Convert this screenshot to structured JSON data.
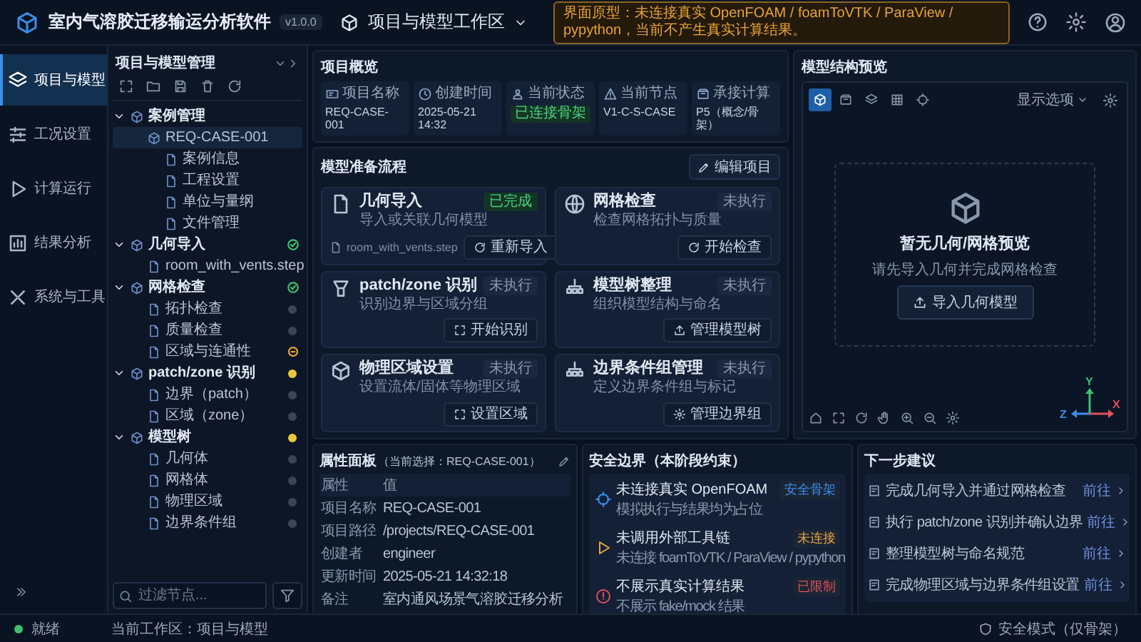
{
  "header": {
    "app_title": "室内气溶胶迁移输运分析软件",
    "version": "v1.0.0",
    "workspace": "项目与模型工作区",
    "notice": "界面原型：未连接真实 OpenFOAM / foamToVTK / ParaView / pypython，当前不产生真实计算结果。"
  },
  "nav": {
    "items": [
      {
        "label": "项目与模型",
        "selected": true
      },
      {
        "label": "工况设置",
        "selected": false
      },
      {
        "label": "计算运行",
        "selected": false
      },
      {
        "label": "结果分析",
        "selected": false
      },
      {
        "label": "系统与工具",
        "selected": false
      }
    ]
  },
  "tree_panel": {
    "title": "项目与模型管理",
    "filter_placeholder": "过滤节点...",
    "nodes": [
      {
        "label": "案例管理",
        "expanded": true,
        "selected": false,
        "children": [
          {
            "label": "REQ-CASE-001",
            "selected": true,
            "children": [
              {
                "label": "案例信息",
                "selected": false
              },
              {
                "label": "工程设置",
                "selected": false
              },
              {
                "label": "单位与量纲",
                "selected": false
              },
              {
                "label": "文件管理",
                "selected": false
              }
            ]
          }
        ]
      },
      {
        "label": "几何导入",
        "expanded": true,
        "selected": false,
        "kind": "check",
        "color": "#3fbf6f",
        "children": [
          {
            "label": "room_with_vents.step",
            "selected": false
          }
        ]
      },
      {
        "label": "网格检查",
        "expanded": true,
        "selected": false,
        "kind": "check",
        "color": "#3fbf6f",
        "children": [
          {
            "label": "拓扑检查",
            "selected": false,
            "kind": "dot",
            "color": "#3a4658"
          },
          {
            "label": "质量检查",
            "selected": false,
            "kind": "dot",
            "color": "#3a4658"
          },
          {
            "label": "区域与连通性",
            "selected": false,
            "kind": "ring",
            "color": "#e8a33a"
          }
        ]
      },
      {
        "label": "patch/zone 识别",
        "expanded": true,
        "selected": false,
        "kind": "dot",
        "color": "#e8c53a",
        "children": [
          {
            "label": "边界（patch）",
            "selected": false,
            "kind": "dot",
            "color": "#3a4658"
          },
          {
            "label": "区域（zone）",
            "selected": false,
            "kind": "dot",
            "color": "#3a4658"
          }
        ]
      },
      {
        "label": "模型树",
        "expanded": true,
        "selected": false,
        "kind": "dot",
        "color": "#e8c53a",
        "children": [
          {
            "label": "几何体",
            "selected": false,
            "kind": "dot",
            "color": "#3a4658"
          },
          {
            "label": "网格体",
            "selected": false,
            "kind": "dot",
            "color": "#3a4658"
          },
          {
            "label": "物理区域",
            "selected": false,
            "kind": "dot",
            "color": "#3a4658"
          },
          {
            "label": "边界条件组",
            "selected": false,
            "kind": "dot",
            "color": "#3a4658"
          }
        ]
      }
    ]
  },
  "overview": {
    "title": "项目概览",
    "cards": [
      {
        "label": "项目名称",
        "value": "REQ-CASE-001",
        "kind": "text"
      },
      {
        "label": "创建时间",
        "value": "2025-05-21 14:32",
        "kind": "text"
      },
      {
        "label": "当前状态",
        "value": "已连接骨架",
        "kind": "badge"
      },
      {
        "label": "当前节点",
        "value": "V1-C-S-CASE",
        "kind": "text"
      },
      {
        "label": "承接计算",
        "value": "P5（概念/骨架）",
        "kind": "text"
      }
    ]
  },
  "flow": {
    "title": "模型准备流程",
    "edit_button": "编辑项目",
    "steps": [
      {
        "title": "几何导入",
        "desc": "导入或关联几何模型",
        "done": true,
        "badge": "已完成",
        "file": "room_with_vents.step",
        "action": "重新导入"
      },
      {
        "title": "网格检查",
        "desc": "检查网格拓扑与质量",
        "done": false,
        "badge": "未执行",
        "action": "开始检查"
      },
      {
        "title": "patch/zone 识别",
        "desc": "识别边界与区域分组",
        "done": false,
        "badge": "未执行",
        "action": "开始识别"
      },
      {
        "title": "模型树整理",
        "desc": "组织模型结构与命名",
        "done": false,
        "badge": "未执行",
        "action": "管理模型树"
      },
      {
        "title": "物理区域设置",
        "desc": "设置流体/固体等物理区域",
        "done": false,
        "badge": "未执行",
        "action": "设置区域"
      },
      {
        "title": "边界条件组管理",
        "desc": "定义边界条件组与标记",
        "done": false,
        "badge": "未执行",
        "action": "管理边界组"
      }
    ]
  },
  "preview": {
    "title": "模型结构预览",
    "view_modes": [
      {
        "selected": true
      },
      {
        "selected": false
      },
      {
        "selected": false
      },
      {
        "selected": false
      },
      {
        "selected": false
      }
    ],
    "display_options": "显示选项",
    "empty_title": "暂无几何/网格预览",
    "empty_hint": "请先导入几何并完成网格检查",
    "import_button": "导入几何模型",
    "axes": {
      "y": "Y",
      "z": "Z",
      "x": "X"
    }
  },
  "properties": {
    "title": "属性面板",
    "selection": "（当前选择：REQ-CASE-001）",
    "columns": [
      "属性",
      "值"
    ],
    "rows": [
      [
        "项目名称",
        "REQ-CASE-001"
      ],
      [
        "项目路径",
        "/projects/REQ-CASE-001"
      ],
      [
        "创建者",
        "engineer"
      ],
      [
        "更新时间",
        "2025-05-21 14:32:18"
      ],
      [
        "备注",
        "室内通风场景气溶胶迁移分析"
      ]
    ]
  },
  "safety": {
    "title": "安全边界（本阶段约束）",
    "items": [
      {
        "title": "未连接真实 OpenFOAM",
        "desc": "模拟执行与结果均为占位",
        "badge": "安全骨架",
        "color": "#3b8eea"
      },
      {
        "title": "未调用外部工具链",
        "desc": "未连接 foamToVTK / ParaView / pypython",
        "badge": "未连接",
        "color": "#e8a33a"
      },
      {
        "title": "不展示真实计算结果",
        "desc": "不展示 fake/mock 结果",
        "badge": "已限制",
        "color": "#e0525a"
      }
    ]
  },
  "next_steps": {
    "title": "下一步建议",
    "items": [
      {
        "text": "完成几何导入并通过网格检查",
        "link": "前往"
      },
      {
        "text": "执行 patch/zone 识别并确认边界",
        "link": "前往"
      },
      {
        "text": "整理模型树与命名规范",
        "link": "前往"
      },
      {
        "text": "完成物理区域与边界条件组设置",
        "link": "前往"
      }
    ]
  },
  "status_bar": {
    "state": "就绪",
    "workspace": "当前工作区：项目与模型",
    "mode": "安全模式（仅骨架）"
  }
}
